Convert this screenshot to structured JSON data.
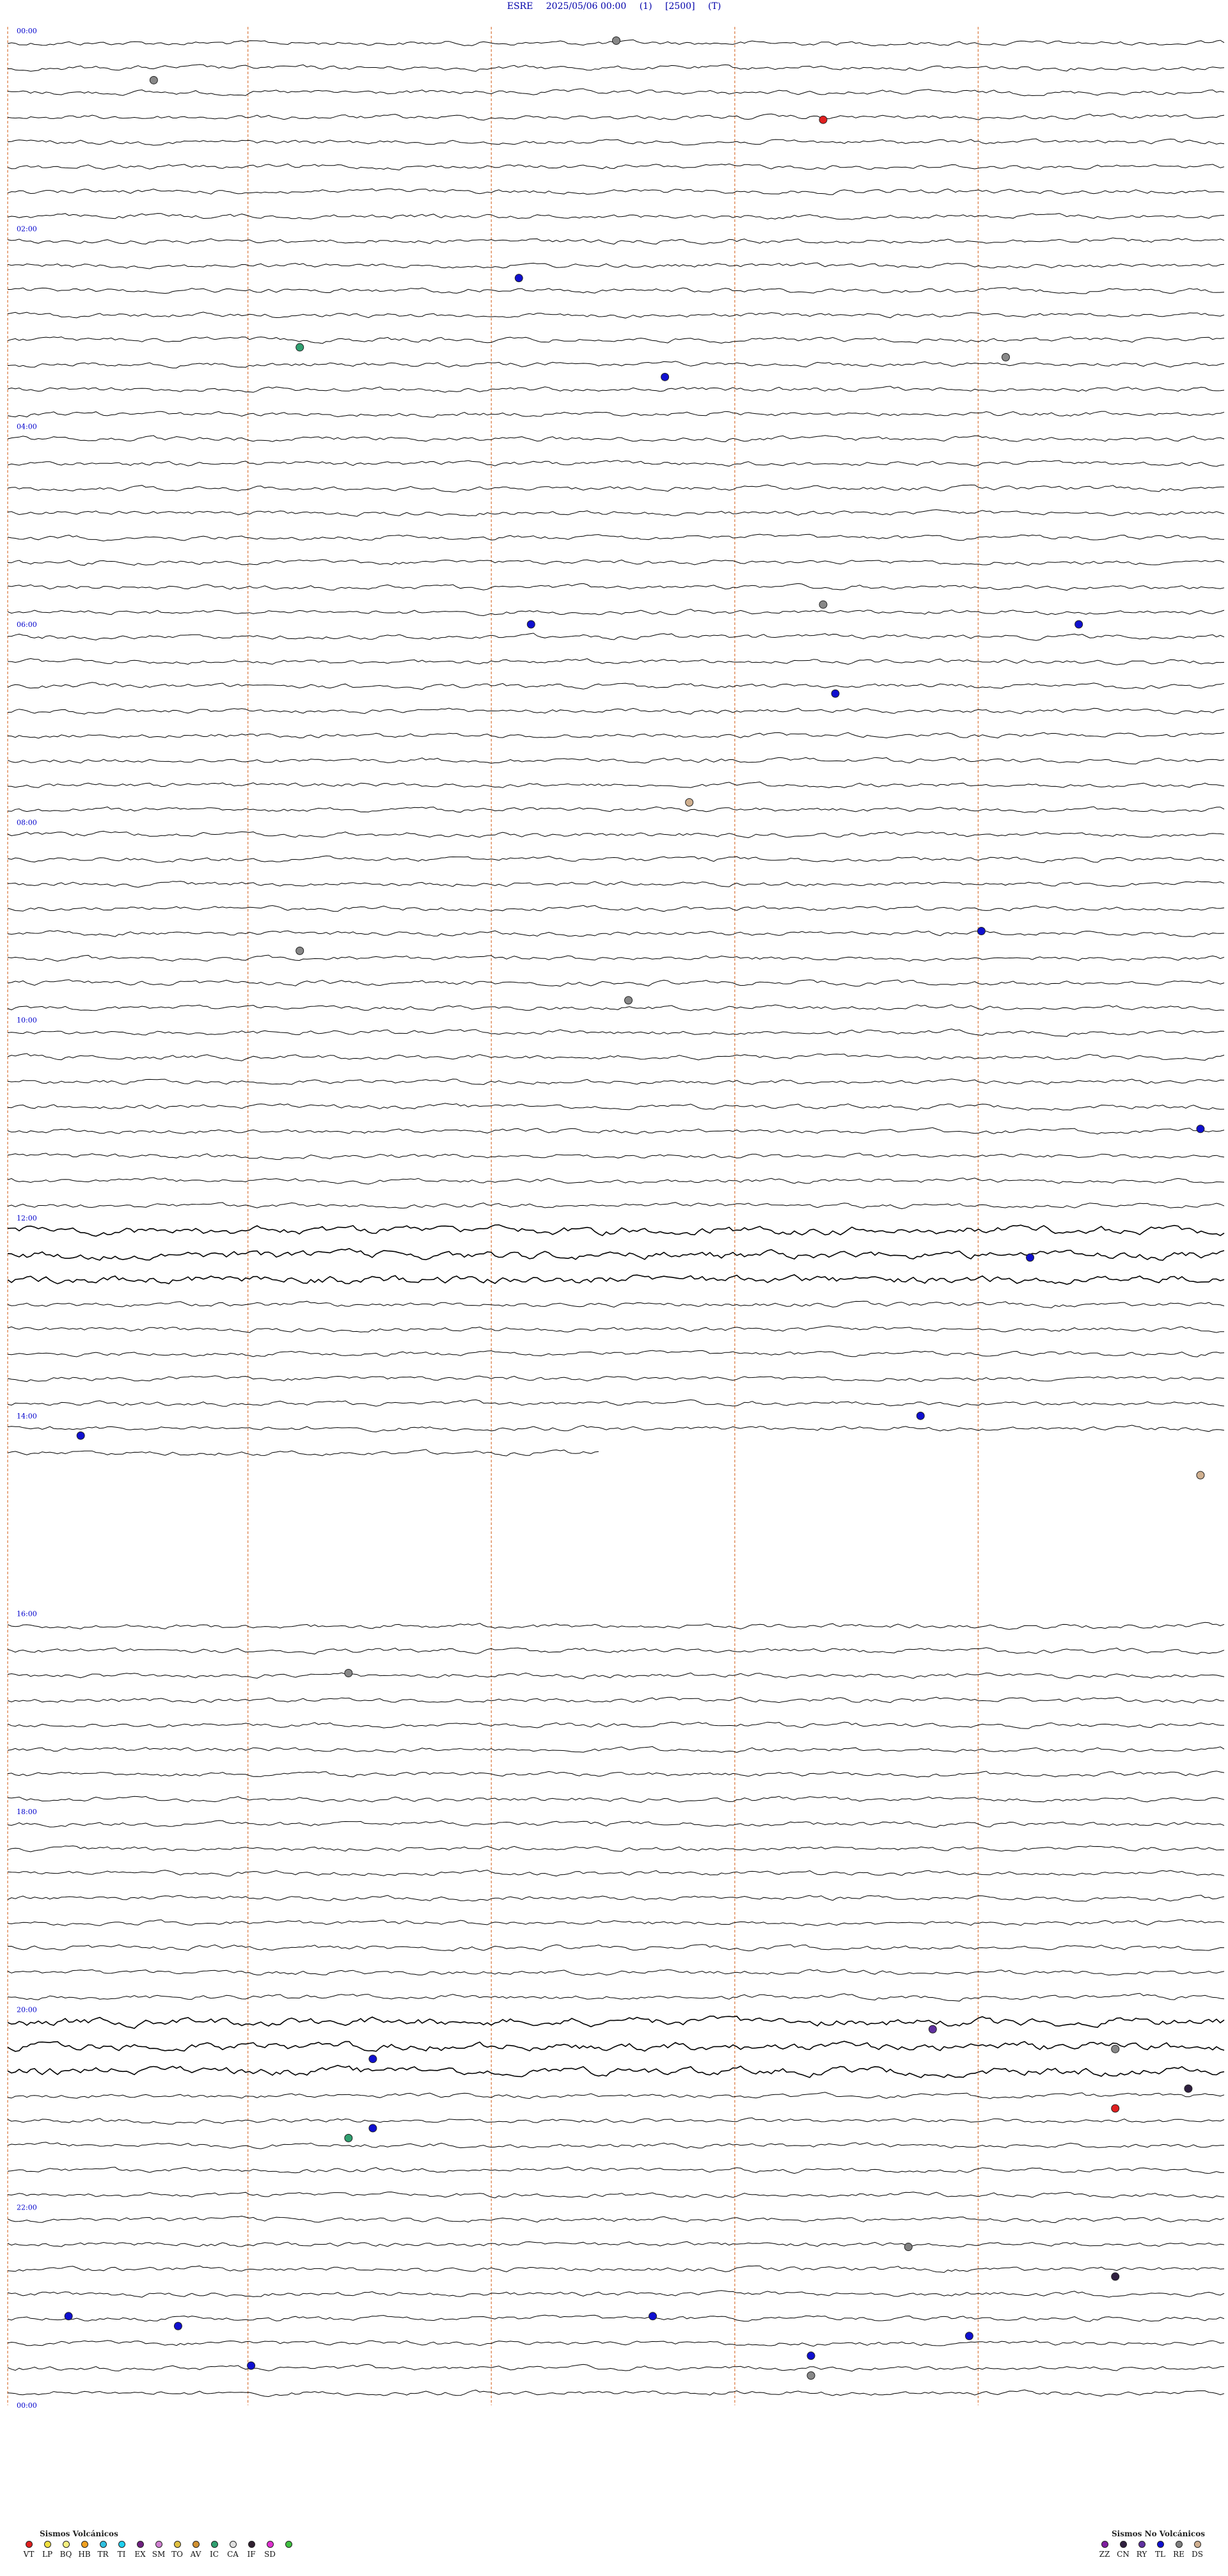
{
  "header": {
    "station": "ESRE",
    "datetime": "2025/05/06 00:00",
    "channel": "(1)",
    "scale": "[2500]",
    "flag": "(T)"
  },
  "time_labels": [
    "00:00",
    "02:00",
    "04:00",
    "06:00",
    "08:00",
    "10:00",
    "12:00",
    "14:00",
    "16:00",
    "18:00",
    "20:00",
    "22:00",
    "00:00"
  ],
  "legend_volcanic": {
    "title": "Sismos Volcánicos",
    "items": [
      {
        "code": "VT",
        "color": "#e02020"
      },
      {
        "code": "LP",
        "color": "#f0e040"
      },
      {
        "code": "BQ",
        "color": "#f5f080"
      },
      {
        "code": "HB",
        "color": "#f0a020"
      },
      {
        "code": "TR",
        "color": "#30c0e0"
      },
      {
        "code": "TI",
        "color": "#20d0f0"
      },
      {
        "code": "EX",
        "color": "#702080"
      },
      {
        "code": "SM",
        "color": "#d080d0"
      },
      {
        "code": "TO",
        "color": "#e0c040"
      },
      {
        "code": "AV",
        "color": "#d09030"
      },
      {
        "code": "IC",
        "color": "#30a070"
      },
      {
        "code": "CA",
        "color": "#e0e0e0"
      },
      {
        "code": "IF",
        "color": "#302030"
      },
      {
        "code": "SD",
        "color": "#e030d0"
      },
      {
        "code": "",
        "color": "#40c040"
      }
    ]
  },
  "legend_nonvolcanic": {
    "title": "Sismos No Volcánicos",
    "items": [
      {
        "code": "ZZ",
        "color": "#8020a0"
      },
      {
        "code": "CN",
        "color": "#302040"
      },
      {
        "code": "RY",
        "color": "#6030a0"
      },
      {
        "code": "TL",
        "color": "#1010d0"
      },
      {
        "code": "RE",
        "color": "#808080"
      },
      {
        "code": "DS",
        "color": "#d0b090"
      }
    ]
  },
  "colors": {
    "trace": "#000000",
    "vertical_guides": "#e09060",
    "time_labels": "#0000cc",
    "header": "#0000aa"
  },
  "events": [
    {
      "hour": 0.1,
      "frac": 0.5,
      "color": "#888888"
    },
    {
      "hour": 0.5,
      "frac": 0.12,
      "color": "#888888"
    },
    {
      "hour": 0.9,
      "frac": 0.67,
      "color": "#e02020"
    },
    {
      "hour": 2.5,
      "frac": 0.42,
      "color": "#1010d0"
    },
    {
      "hour": 3.2,
      "frac": 0.24,
      "color": "#30a070"
    },
    {
      "hour": 3.5,
      "frac": 0.54,
      "color": "#1010d0"
    },
    {
      "hour": 3.3,
      "frac": 0.82,
      "color": "#888888"
    },
    {
      "hour": 5.8,
      "frac": 0.67,
      "color": "#888888"
    },
    {
      "hour": 6.0,
      "frac": 0.43,
      "color": "#1010d0"
    },
    {
      "hour": 6.0,
      "frac": 0.88,
      "color": "#1010d0"
    },
    {
      "hour": 6.7,
      "frac": 0.68,
      "color": "#1010d0"
    },
    {
      "hour": 7.8,
      "frac": 0.56,
      "color": "#d0b090"
    },
    {
      "hour": 9.1,
      "frac": 0.8,
      "color": "#1010d0"
    },
    {
      "hour": 9.3,
      "frac": 0.24,
      "color": "#888888"
    },
    {
      "hour": 9.8,
      "frac": 0.51,
      "color": "#888888"
    },
    {
      "hour": 11.1,
      "frac": 0.98,
      "color": "#1010d0"
    },
    {
      "hour": 12.4,
      "frac": 0.84,
      "color": "#1010d0"
    },
    {
      "hour": 14.0,
      "frac": 0.75,
      "color": "#1010d0"
    },
    {
      "hour": 14.2,
      "frac": 0.06,
      "color": "#1010d0"
    },
    {
      "hour": 14.6,
      "frac": 0.98,
      "color": "#d0b090"
    },
    {
      "hour": 16.6,
      "frac": 0.28,
      "color": "#888888"
    },
    {
      "hour": 20.2,
      "frac": 0.76,
      "color": "#6030a0"
    },
    {
      "hour": 20.4,
      "frac": 0.91,
      "color": "#888888"
    },
    {
      "hour": 20.5,
      "frac": 0.3,
      "color": "#1010d0"
    },
    {
      "hour": 20.8,
      "frac": 0.97,
      "color": "#302040"
    },
    {
      "hour": 21.0,
      "frac": 0.91,
      "color": "#e02020"
    },
    {
      "hour": 21.2,
      "frac": 0.3,
      "color": "#1010d0"
    },
    {
      "hour": 21.3,
      "frac": 0.28,
      "color": "#30a070"
    },
    {
      "hour": 22.4,
      "frac": 0.74,
      "color": "#808080"
    },
    {
      "hour": 22.7,
      "frac": 0.91,
      "color": "#302040"
    },
    {
      "hour": 23.1,
      "frac": 0.53,
      "color": "#1010d0"
    },
    {
      "hour": 23.1,
      "frac": 0.05,
      "color": "#1010d0"
    },
    {
      "hour": 23.2,
      "frac": 0.14,
      "color": "#1010d0"
    },
    {
      "hour": 23.3,
      "frac": 0.79,
      "color": "#1010d0"
    },
    {
      "hour": 23.5,
      "frac": 0.66,
      "color": "#1010d0"
    },
    {
      "hour": 23.6,
      "frac": 0.2,
      "color": "#1010d0"
    },
    {
      "hour": 23.7,
      "frac": 0.66,
      "color": "#888888"
    }
  ]
}
